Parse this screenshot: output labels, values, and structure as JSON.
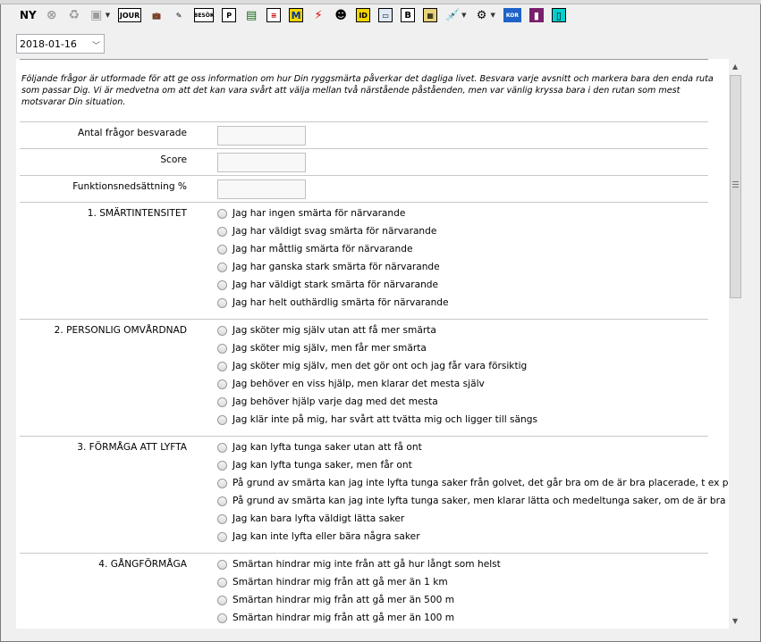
{
  "toolbar": {
    "new_label": "NY",
    "icons": [
      "close-circle-icon",
      "sync-icon",
      "save-icon",
      "journal-icon",
      "briefcase-icon",
      "edit-icon",
      "besok-icon",
      "patient-p-icon",
      "book-icon",
      "lab-icon",
      "m-icon",
      "prescription-icon",
      "user-icon",
      "id-icon",
      "image-icon",
      "b-doc-icon",
      "grid-icon",
      "injection-icon",
      "settings-icon",
      "kortdata-icon",
      "folder-icon",
      "cyan-icon"
    ],
    "icon_text": {
      "journal": "JOUR",
      "besok": "BESÖK",
      "p": "P",
      "m": "M",
      "id": "ID",
      "b": "B",
      "kort": "KOR"
    }
  },
  "date_select": {
    "value": "2018-01-16"
  },
  "form": {
    "intro": "Följande frågor är utformade för att ge oss information om hur Din ryggsmärta påverkar det dagliga livet. Besvara varje avsnitt och markera bara den enda ruta som passar Dig. Vi är medvetna om att det kan vara svårt att välja mellan två närstående påståenden, men var vänlig kryssa bara i den rutan som mest motsvarar Din situation.",
    "fields": [
      {
        "label": "Antal frågor besvarade",
        "value": ""
      },
      {
        "label": "Score",
        "value": ""
      },
      {
        "label": "Funktionsnedsättning %",
        "value": ""
      }
    ],
    "sections": [
      {
        "title": "1. SMÄRTINTENSITET",
        "options": [
          "Jag har ingen smärta för närvarande",
          "Jag har väldigt svag smärta för närvarande",
          "Jag har måttlig smärta för närvarande",
          "Jag har ganska stark smärta för närvarande",
          "Jag har väldigt stark smärta för närvarande",
          "Jag har helt outhärdlig smärta för närvarande"
        ]
      },
      {
        "title": "2. PERSONLIG OMVÅRDNAD",
        "options": [
          "Jag sköter mig själv utan att få mer smärta",
          "Jag sköter mig själv, men får mer smärta",
          "Jag sköter mig själv, men det gör ont och jag får vara försiktig",
          "Jag behöver en viss hjälp, men klarar det mesta själv",
          "Jag behöver hjälp varje dag med det mesta",
          "Jag klär inte på mig, har svårt att tvätta mig och ligger till sängs"
        ]
      },
      {
        "title": "3. FÖRMÅGA ATT LYFTA",
        "options": [
          "Jag kan lyfta tunga saker utan att få ont",
          "Jag kan lyfta tunga saker, men får ont",
          "På grund av smärta kan jag inte lyfta tunga saker från golvet, det går bra om de är bra placerade, t ex på",
          "På grund av smärta kan jag inte lyfta tunga saker, men klarar lätta och medeltunga saker, om de är bra p",
          "Jag kan bara lyfta väldigt lätta saker",
          "Jag kan inte lyfta eller bära några saker"
        ]
      },
      {
        "title": "4. GÅNGFÖRMÅGA",
        "options": [
          "Smärtan hindrar mig inte från att gå hur långt som helst",
          "Smärtan hindrar mig från att gå mer än 1 km",
          "Smärtan hindrar mig från att gå mer än 500 m",
          "Smärtan hindrar mig från att gå mer än 100 m"
        ]
      }
    ]
  }
}
